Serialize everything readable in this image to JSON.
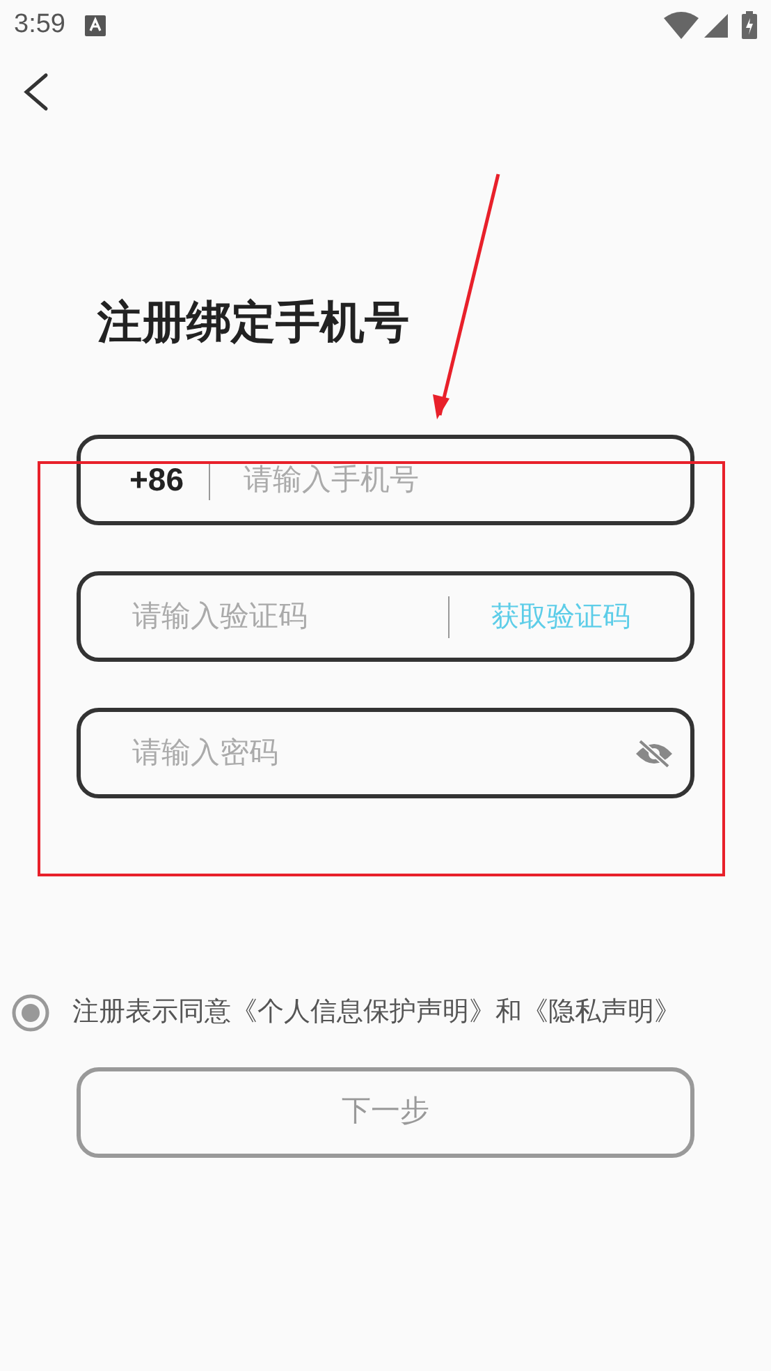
{
  "status_bar": {
    "time": "3:59"
  },
  "title": "注册绑定手机号",
  "phone_field": {
    "country_code": "+86",
    "placeholder": "请输入手机号"
  },
  "code_field": {
    "placeholder": "请输入验证码",
    "action": "获取验证码"
  },
  "password_field": {
    "placeholder": "请输入密码",
    "visible": false
  },
  "agreement": {
    "text": "注册表示同意《个人信息保护声明》和《隐私声明》",
    "selected": true
  },
  "next_button": {
    "label": "下一步",
    "disabled": true
  }
}
